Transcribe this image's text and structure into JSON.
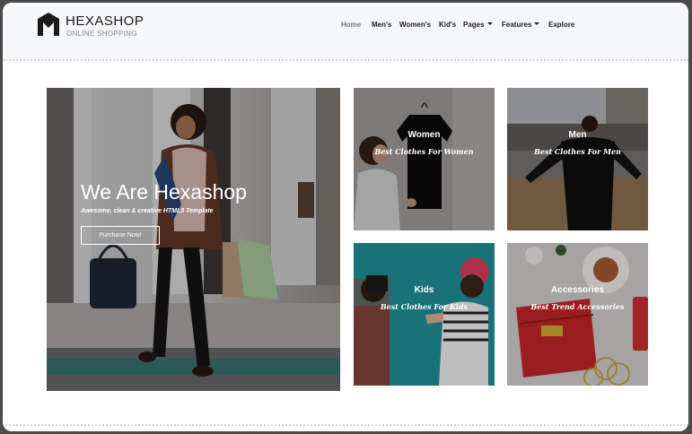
{
  "brand": {
    "name": "HEXASHOP",
    "tagline": "ONLINE SHOPPING",
    "logo_letter": "M"
  },
  "nav": [
    {
      "label": "Home",
      "active": true,
      "dropdown": false
    },
    {
      "label": "Men's",
      "active": false,
      "dropdown": false
    },
    {
      "label": "Women's",
      "active": false,
      "dropdown": false
    },
    {
      "label": "Kid's",
      "active": false,
      "dropdown": false
    },
    {
      "label": "Pages",
      "active": false,
      "dropdown": true
    },
    {
      "label": "Features",
      "active": false,
      "dropdown": true
    },
    {
      "label": "Explore",
      "active": false,
      "dropdown": false
    }
  ],
  "hero": {
    "title": "We Are Hexashop",
    "subtitle": "Awesome, clean & creative HTML5 Template",
    "button_label": "Purchase Now!"
  },
  "categories": [
    {
      "title": "Women",
      "subtitle": "Best Clothes For Women"
    },
    {
      "title": "Men",
      "subtitle": "Best Clothes For Men"
    },
    {
      "title": "Kids",
      "subtitle": "Best Clothes For Kids"
    },
    {
      "title": "Accessories",
      "subtitle": "Best Trend Accessories"
    }
  ],
  "colors": {
    "header_bg": "#f6f7f9",
    "text_dark": "#1e1e1e",
    "active_nav": "#7a7a7a",
    "kids_tile_bg": "#1f8c93",
    "accessories_bag": "#c6262a"
  }
}
